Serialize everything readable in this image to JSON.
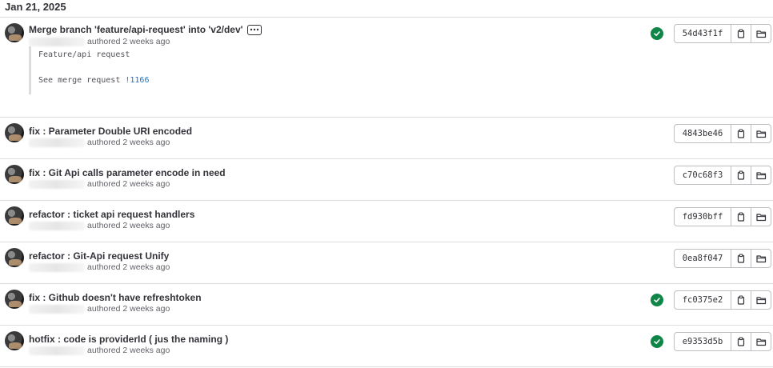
{
  "date_header": "Jan 21, 2025",
  "authored_text": "authored 2 weeks ago",
  "colors": {
    "pipeline_success": "#108548",
    "link": "#1f75cb"
  },
  "icons": {
    "status": "check-circle-icon",
    "copy": "copy-to-clipboard-icon",
    "browse": "folder-open-icon"
  },
  "commits": [
    {
      "title": "Merge branch 'feature/api-request' into 'v2/dev'",
      "sha": "54d43f1f",
      "has_pipeline_success": true,
      "description": {
        "line1": "Feature/api request",
        "line2_prefix": "See merge request ",
        "mr_link": "!1166"
      }
    },
    {
      "title": "fix : Parameter Double URI encoded",
      "sha": "4843be46",
      "has_pipeline_success": false
    },
    {
      "title": "fix : Git Api calls parameter encode in need",
      "sha": "c70c68f3",
      "has_pipeline_success": false
    },
    {
      "title": "refactor : ticket api request handlers",
      "sha": "fd930bff",
      "has_pipeline_success": false
    },
    {
      "title": "refactor : Git-Api request Unify",
      "sha": "0ea8f047",
      "has_pipeline_success": false
    },
    {
      "title": "fix : Github doesn't have refreshtoken",
      "sha": "fc0375e2",
      "has_pipeline_success": true
    },
    {
      "title": "hotfix : code is providerId ( jus the naming )",
      "sha": "e9353d5b",
      "has_pipeline_success": true
    }
  ]
}
